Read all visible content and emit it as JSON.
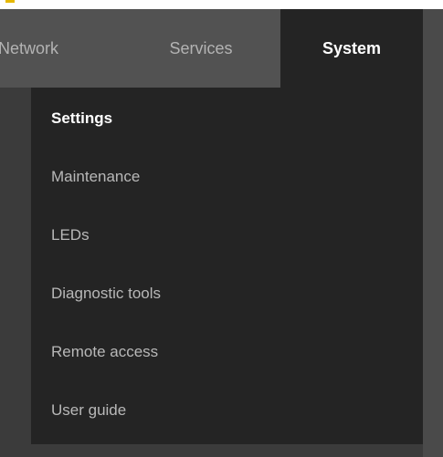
{
  "tabs": [
    {
      "label": "Network"
    },
    {
      "label": "Services"
    },
    {
      "label": "System"
    }
  ],
  "menu": {
    "items": [
      {
        "label": "Settings"
      },
      {
        "label": "Maintenance"
      },
      {
        "label": "LEDs"
      },
      {
        "label": "Diagnostic tools"
      },
      {
        "label": "Remote access"
      },
      {
        "label": "User guide"
      }
    ]
  },
  "colors": {
    "background": "#3b3b3b",
    "nav_bar": "#525252",
    "active_tab": "#242424",
    "menu_panel": "#242424",
    "active_text": "#ffffff",
    "inactive_text": "#b3b3b3"
  }
}
